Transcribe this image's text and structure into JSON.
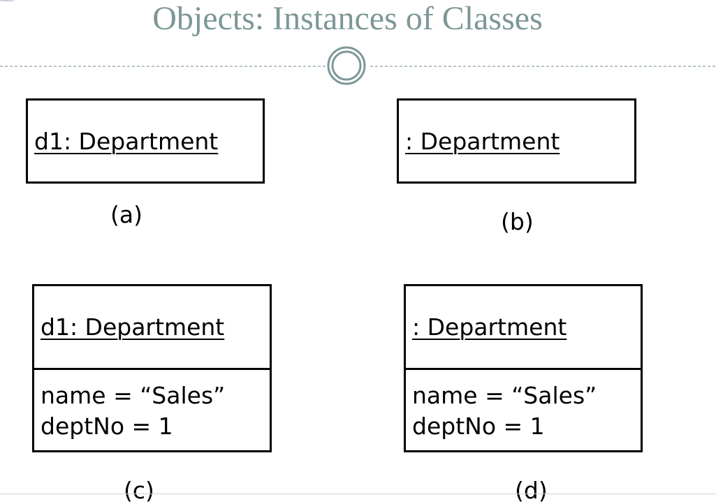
{
  "slide": {
    "logo_text": "TECHNOLOGY",
    "title": "Objects: Instances of Classes"
  },
  "diagrams": [
    {
      "object_name": "d1: Department",
      "attributes": [],
      "caption": "(a)"
    },
    {
      "object_name": ": Department",
      "attributes": [],
      "caption": "(b)"
    },
    {
      "object_name": "d1: Department",
      "attributes": [
        "name = “Sales”",
        "deptNo = 1"
      ],
      "caption": "(c)"
    },
    {
      "object_name": ": Department",
      "attributes": [
        "name = “Sales”",
        "deptNo = 1"
      ],
      "caption": "(d)"
    }
  ],
  "colors": {
    "title": "#7d9796",
    "divider": "#8aa3a2"
  }
}
